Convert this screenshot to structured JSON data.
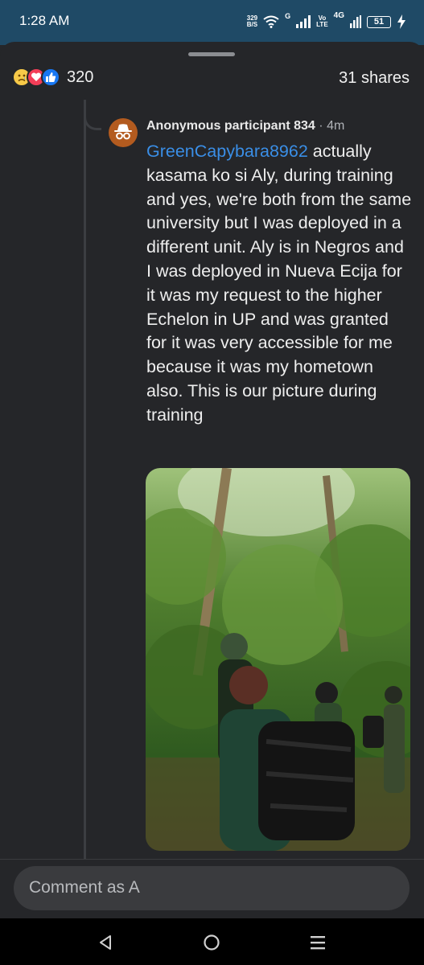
{
  "status_bar": {
    "time": "1:28 AM",
    "net_speed_value": "329",
    "net_speed_unit": "B/S",
    "network_g": "G",
    "volte_top": "Vo",
    "volte_bottom": "LTE",
    "network_4g": "4G",
    "battery_level": "51",
    "icons": [
      "wifi-icon",
      "signal-icon",
      "charging-icon"
    ]
  },
  "post_summary": {
    "reaction_icons": [
      "sad-reaction-icon",
      "love-reaction-icon",
      "like-reaction-icon"
    ],
    "reaction_count": "320",
    "shares": "31 shares"
  },
  "comment": {
    "author": "Anonymous participant 834",
    "separator": "·",
    "time": "4m",
    "avatar_icon": "incognito-icon",
    "avatar_color": "#b35b1f",
    "mention": "GreenCapybara8962",
    "text": " actually kasama ko si Aly, during training and yes, we're both from the same university but I was deployed in a different unit. Aly is in Negros and I was deployed in Nueva Ecija for it was my request to the higher Echelon in UP and was granted for  it was very accessible for me because it was my hometown also. This is our picture during training",
    "mention_color": "#3a8ee6"
  },
  "composer": {
    "placeholder": "Comment as A"
  },
  "nav": {
    "icons": [
      "back-icon",
      "home-icon",
      "recents-icon"
    ]
  },
  "colors": {
    "status_bar_bg": "#1f4a66",
    "sheet_bg": "#252629",
    "composer_bg": "#3a3b3e"
  }
}
